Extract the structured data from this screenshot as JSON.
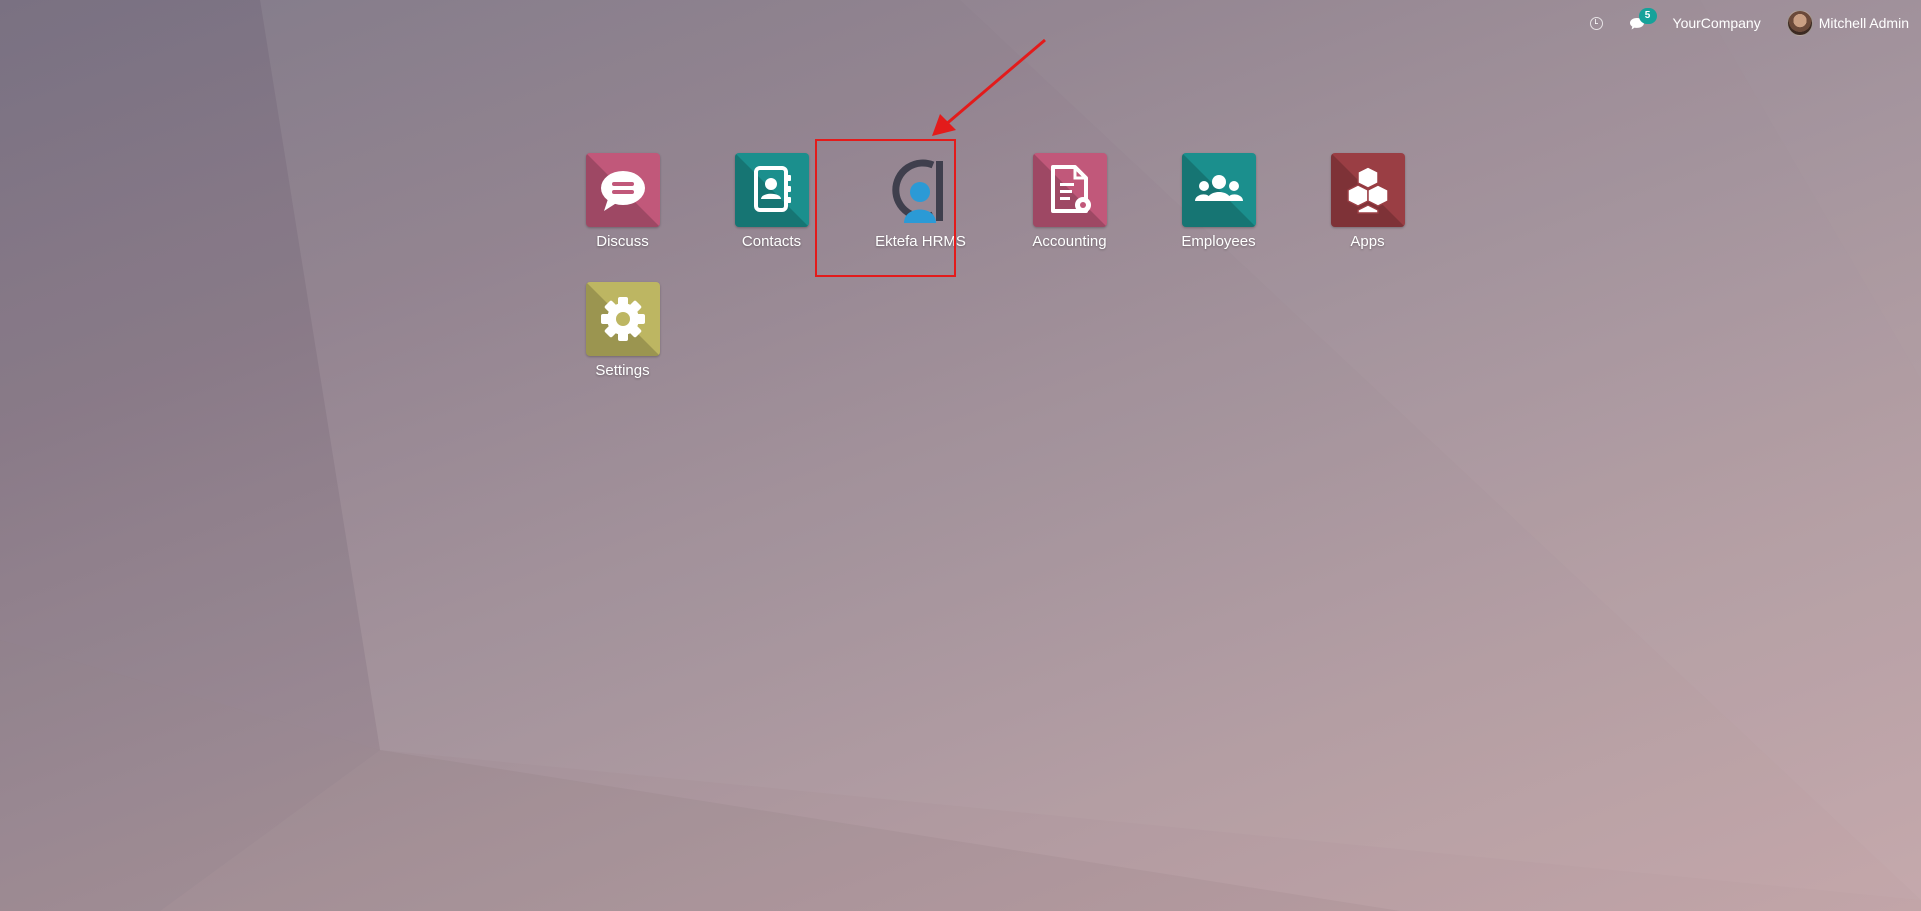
{
  "topbar": {
    "clock_icon": "clock-icon",
    "chat_icon": "chat-icon",
    "message_count": "5",
    "company": "YourCompany",
    "user_name": "Mitchell Admin"
  },
  "apps": [
    {
      "label": "Discuss",
      "icon": "chat-bubble-icon",
      "color": "#c1587a"
    },
    {
      "label": "Contacts",
      "icon": "address-book-icon",
      "color": "#1b8f8d"
    },
    {
      "label": "Ektefa HRMS",
      "icon": "ektefa-logo-icon",
      "color": "transparent"
    },
    {
      "label": "Accounting",
      "icon": "document-gear-icon",
      "color": "#c1587a"
    },
    {
      "label": "Employees",
      "icon": "users-icon",
      "color": "#1b8f8d"
    },
    {
      "label": "Apps",
      "icon": "cubes-icon",
      "color": "#9a3e44"
    },
    {
      "label": "Settings",
      "icon": "gear-icon",
      "color": "#bdb662"
    }
  ],
  "annotation": {
    "color": "#e31b1b"
  }
}
